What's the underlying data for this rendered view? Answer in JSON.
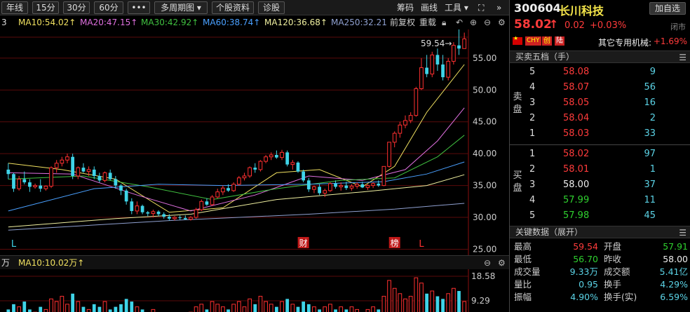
{
  "toolbar": {
    "buttons": [
      "年线",
      "15分",
      "30分",
      "60分",
      "•••",
      "多周期图 ▾",
      "个股资料",
      "诊股"
    ],
    "right_tools": [
      "筹码",
      "画线",
      "工具 ▾"
    ],
    "expand_icon": "⛶",
    "collapse_icon": "»"
  },
  "ma_legend": {
    "prefix": "3",
    "items": [
      {
        "label": "MA10:54.02↑",
        "color": "#f0e060"
      },
      {
        "label": "MA20:47.15↑",
        "color": "#e070e0"
      },
      {
        "label": "MA30:42.92↑",
        "color": "#40c040"
      },
      {
        "label": "MA60:38.74↑",
        "color": "#4aa0ff"
      },
      {
        "label": "MA120:36.68↑",
        "color": "#f0f0a0"
      },
      {
        "label": "MA250:32.21",
        "color": "#8fa0d0"
      }
    ],
    "adjust": "前复权",
    "overlay": "重载"
  },
  "chart_data": {
    "type": "candlestick",
    "y_ticks": [
      "55.00",
      "50.00",
      "45.00",
      "40.00",
      "35.00",
      "30.00",
      "25.00"
    ],
    "ylim": [
      24.5,
      59.5
    ],
    "high_label": "59.54→",
    "markers": [
      {
        "text": "L",
        "index": 1,
        "style": "plain"
      },
      {
        "text": "财",
        "index": 55,
        "style": "box"
      },
      {
        "text": "榜",
        "index": 72,
        "style": "box"
      },
      {
        "text": "L",
        "index": 77,
        "style": "plain"
      }
    ],
    "candles": [
      [
        37.5,
        38.5,
        36.0,
        36.8
      ],
      [
        36.8,
        37.0,
        34.0,
        34.5
      ],
      [
        34.5,
        36.5,
        34.2,
        36.0
      ],
      [
        36.0,
        37.2,
        35.2,
        35.5
      ],
      [
        35.5,
        36.0,
        34.0,
        34.8
      ],
      [
        34.8,
        35.3,
        34.5,
        35.0
      ],
      [
        35.0,
        36.0,
        34.0,
        34.5
      ],
      [
        34.5,
        35.0,
        34.2,
        34.9
      ],
      [
        34.9,
        38.0,
        34.6,
        37.8
      ],
      [
        37.8,
        39.0,
        37.0,
        38.5
      ],
      [
        38.5,
        39.5,
        38.0,
        39.0
      ],
      [
        39.0,
        40.0,
        38.5,
        39.5
      ],
      [
        39.5,
        40.0,
        36.0,
        36.5
      ],
      [
        36.5,
        38.0,
        36.0,
        37.8
      ],
      [
        37.8,
        38.5,
        37.0,
        37.2
      ],
      [
        37.2,
        38.0,
        36.5,
        37.5
      ],
      [
        37.5,
        38.0,
        36.0,
        36.5
      ],
      [
        36.5,
        37.0,
        35.5,
        35.8
      ],
      [
        35.8,
        37.2,
        35.5,
        37.0
      ],
      [
        37.0,
        37.5,
        35.8,
        36.0
      ],
      [
        36.0,
        36.5,
        34.5,
        35.0
      ],
      [
        35.0,
        35.2,
        33.5,
        34.2
      ],
      [
        34.2,
        34.5,
        32.0,
        32.5
      ],
      [
        32.5,
        33.0,
        30.5,
        31.0
      ],
      [
        31.0,
        32.5,
        30.5,
        31.8
      ],
      [
        31.8,
        32.0,
        30.5,
        30.8
      ],
      [
        30.8,
        31.0,
        30.2,
        30.6
      ],
      [
        30.6,
        31.2,
        30.0,
        30.9
      ],
      [
        30.9,
        31.1,
        30.2,
        30.5
      ],
      [
        30.5,
        30.8,
        29.8,
        30.1
      ],
      [
        30.1,
        30.5,
        29.5,
        29.8
      ],
      [
        29.8,
        30.2,
        29.5,
        30.0
      ],
      [
        30.0,
        30.3,
        29.6,
        29.9
      ],
      [
        29.9,
        30.3,
        29.6,
        29.7
      ],
      [
        29.7,
        30.2,
        29.5,
        30.0
      ],
      [
        30.0,
        31.5,
        29.8,
        31.2
      ],
      [
        31.2,
        32.8,
        31.0,
        32.5
      ],
      [
        32.5,
        33.0,
        31.8,
        32.0
      ],
      [
        32.0,
        33.5,
        31.8,
        33.2
      ],
      [
        33.2,
        34.5,
        33.0,
        34.0
      ],
      [
        34.0,
        35.0,
        33.5,
        34.6
      ],
      [
        34.6,
        35.2,
        34.0,
        34.2
      ],
      [
        34.2,
        35.5,
        34.0,
        35.2
      ],
      [
        35.2,
        36.5,
        35.0,
        36.2
      ],
      [
        36.2,
        37.0,
        35.8,
        36.5
      ],
      [
        36.5,
        38.0,
        36.2,
        37.8
      ],
      [
        37.8,
        38.5,
        37.0,
        37.5
      ],
      [
        37.5,
        39.0,
        37.2,
        38.8
      ],
      [
        38.8,
        39.8,
        38.5,
        39.5
      ],
      [
        39.5,
        40.2,
        39.0,
        39.8
      ],
      [
        39.8,
        40.5,
        39.2,
        39.4
      ],
      [
        39.4,
        40.6,
        39.0,
        40.2
      ],
      [
        40.2,
        40.5,
        38.0,
        38.3
      ],
      [
        38.3,
        39.0,
        37.5,
        38.6
      ],
      [
        38.6,
        38.8,
        37.0,
        37.2
      ],
      [
        37.2,
        37.5,
        35.5,
        35.8
      ],
      [
        35.8,
        36.2,
        34.0,
        34.4
      ],
      [
        34.4,
        35.0,
        33.8,
        34.8
      ],
      [
        34.8,
        35.2,
        33.5,
        33.8
      ],
      [
        33.8,
        34.5,
        33.2,
        34.2
      ],
      [
        34.2,
        35.5,
        34.0,
        35.3
      ],
      [
        35.3,
        35.8,
        34.5,
        34.8
      ],
      [
        34.8,
        35.5,
        34.2,
        35.0
      ],
      [
        35.0,
        35.6,
        34.3,
        34.6
      ],
      [
        34.6,
        35.2,
        34.2,
        34.9
      ],
      [
        34.9,
        35.5,
        34.5,
        35.2
      ],
      [
        35.2,
        35.6,
        34.6,
        34.7
      ],
      [
        34.7,
        35.2,
        34.3,
        35.0
      ],
      [
        35.0,
        35.5,
        34.6,
        35.3
      ],
      [
        35.3,
        35.8,
        34.8,
        35.0
      ],
      [
        35.0,
        38.0,
        34.9,
        38.0
      ],
      [
        38.0,
        41.8,
        37.8,
        41.8
      ],
      [
        41.8,
        43.5,
        41.0,
        43.2
      ],
      [
        43.2,
        45.0,
        42.5,
        44.5
      ],
      [
        44.5,
        46.0,
        44.0,
        45.2
      ],
      [
        45.2,
        46.5,
        44.8,
        46.0
      ],
      [
        46.0,
        50.5,
        45.8,
        50.2
      ],
      [
        50.2,
        55.0,
        50.0,
        53.5
      ],
      [
        53.5,
        55.5,
        52.0,
        52.5
      ],
      [
        52.5,
        56.0,
        52.0,
        55.5
      ],
      [
        55.5,
        56.5,
        53.0,
        54.0
      ],
      [
        54.0,
        55.5,
        51.5,
        52.0
      ],
      [
        52.0,
        55.0,
        51.5,
        54.5
      ],
      [
        54.5,
        57.5,
        54.0,
        57.0
      ],
      [
        57.0,
        59.54,
        55.5,
        56.5
      ],
      [
        56.5,
        59.0,
        56.7,
        58.02
      ]
    ],
    "ma_series": [
      {
        "name": "MA10",
        "color": "#f0e060",
        "values": [
          [
            0,
            38.5
          ],
          [
            10,
            37.5
          ],
          [
            20,
            36.0
          ],
          [
            30,
            30.8
          ],
          [
            40,
            31.5
          ],
          [
            50,
            37.0
          ],
          [
            58,
            37.5
          ],
          [
            66,
            34.8
          ],
          [
            72,
            38.0
          ],
          [
            78,
            46.5
          ],
          [
            85,
            54.0
          ]
        ]
      },
      {
        "name": "MA20",
        "color": "#e070e0",
        "values": [
          [
            0,
            37.0
          ],
          [
            12,
            36.8
          ],
          [
            24,
            33.5
          ],
          [
            34,
            31.0
          ],
          [
            46,
            33.5
          ],
          [
            56,
            36.5
          ],
          [
            66,
            35.8
          ],
          [
            74,
            37.5
          ],
          [
            80,
            42.0
          ],
          [
            85,
            47.2
          ]
        ]
      },
      {
        "name": "MA30",
        "color": "#40c040",
        "values": [
          [
            0,
            36.0
          ],
          [
            14,
            36.5
          ],
          [
            26,
            34.8
          ],
          [
            38,
            32.8
          ],
          [
            50,
            34.5
          ],
          [
            62,
            35.8
          ],
          [
            72,
            36.2
          ],
          [
            80,
            39.5
          ],
          [
            85,
            42.9
          ]
        ]
      },
      {
        "name": "MA60",
        "color": "#4aa0ff",
        "values": [
          [
            0,
            31.0
          ],
          [
            16,
            34.5
          ],
          [
            28,
            35.2
          ],
          [
            40,
            35.0
          ],
          [
            56,
            35.2
          ],
          [
            70,
            35.6
          ],
          [
            78,
            36.8
          ],
          [
            85,
            38.7
          ]
        ]
      },
      {
        "name": "MA120",
        "color": "#f0f0a0",
        "values": [
          [
            0,
            28.5
          ],
          [
            20,
            29.8
          ],
          [
            34,
            30.5
          ],
          [
            50,
            32.8
          ],
          [
            66,
            34.0
          ],
          [
            78,
            35.0
          ],
          [
            85,
            36.7
          ]
        ]
      },
      {
        "name": "MA250",
        "color": "#8fa0d0",
        "values": [
          [
            0,
            28.0
          ],
          [
            30,
            29.5
          ],
          [
            56,
            30.5
          ],
          [
            72,
            31.3
          ],
          [
            85,
            32.2
          ]
        ]
      }
    ]
  },
  "volume": {
    "prefix": "万",
    "ma_label": "MA10:10.02万↑",
    "y_ticks": [
      "18.58",
      "9.29"
    ],
    "values": [
      6,
      8,
      7,
      9,
      6,
      5,
      7,
      6,
      10,
      9,
      11,
      8,
      12,
      9,
      7,
      6,
      8,
      7,
      9,
      6,
      7,
      8,
      10,
      9,
      7,
      6,
      5,
      6,
      5,
      4,
      5,
      4,
      5,
      4,
      5,
      7,
      8,
      6,
      9,
      8,
      7,
      6,
      8,
      9,
      7,
      10,
      8,
      11,
      9,
      8,
      7,
      9,
      10,
      8,
      7,
      9,
      8,
      7,
      6,
      7,
      8,
      6,
      7,
      6,
      7,
      6,
      5,
      6,
      7,
      6,
      11,
      17,
      14,
      12,
      10,
      11,
      18,
      16,
      12,
      13,
      11,
      10,
      12,
      14,
      13,
      9
    ]
  },
  "stock": {
    "code": "300604",
    "name": "长川科技",
    "add_watch": "加自选",
    "price": "58.02",
    "arrow": "↑",
    "change": "0.02",
    "change_pct": "+0.03%",
    "status": "闭市",
    "tags": [
      "CHY",
      "创",
      "陆"
    ],
    "sector_label": "其它专用机械:",
    "sector_change": "+1.69%"
  },
  "orderbook": {
    "title": "买卖五档（手）",
    "sell_label": "卖盘",
    "buy_label": "买盘",
    "asks": [
      {
        "level": "5",
        "price": "58.08",
        "vol": "9"
      },
      {
        "level": "4",
        "price": "58.07",
        "vol": "56"
      },
      {
        "level": "3",
        "price": "58.05",
        "vol": "16"
      },
      {
        "level": "2",
        "price": "58.04",
        "vol": "2"
      },
      {
        "level": "1",
        "price": "58.03",
        "vol": "33"
      }
    ],
    "bids": [
      {
        "level": "1",
        "price": "58.02",
        "vol": "97",
        "color": "red"
      },
      {
        "level": "2",
        "price": "58.01",
        "vol": "1",
        "color": "red"
      },
      {
        "level": "3",
        "price": "58.00",
        "vol": "37",
        "color": "white"
      },
      {
        "level": "4",
        "price": "57.99",
        "vol": "11",
        "color": "green"
      },
      {
        "level": "5",
        "price": "57.98",
        "vol": "45",
        "color": "green"
      }
    ]
  },
  "key_data": {
    "title": "关键数据（展开）",
    "rows": [
      {
        "l": "最高",
        "lv": "59.54",
        "lc": "red",
        "r": "开盘",
        "rv": "57.91",
        "rc": "green"
      },
      {
        "l": "最低",
        "lv": "56.70",
        "lc": "green",
        "r": "昨收",
        "rv": "58.00",
        "rc": "white"
      },
      {
        "l": "成交量",
        "lv": "9.33万",
        "lc": "cyan",
        "r": "成交额",
        "rv": "5.41亿",
        "rc": "cyan"
      },
      {
        "l": "量比",
        "lv": "0.95",
        "lc": "cyan",
        "r": "换手",
        "rv": "4.29%",
        "rc": "cyan"
      },
      {
        "l": "振幅",
        "lv": "4.90%",
        "lc": "cyan",
        "r": "换手(实)",
        "rv": "6.59%",
        "rc": "cyan"
      }
    ]
  }
}
